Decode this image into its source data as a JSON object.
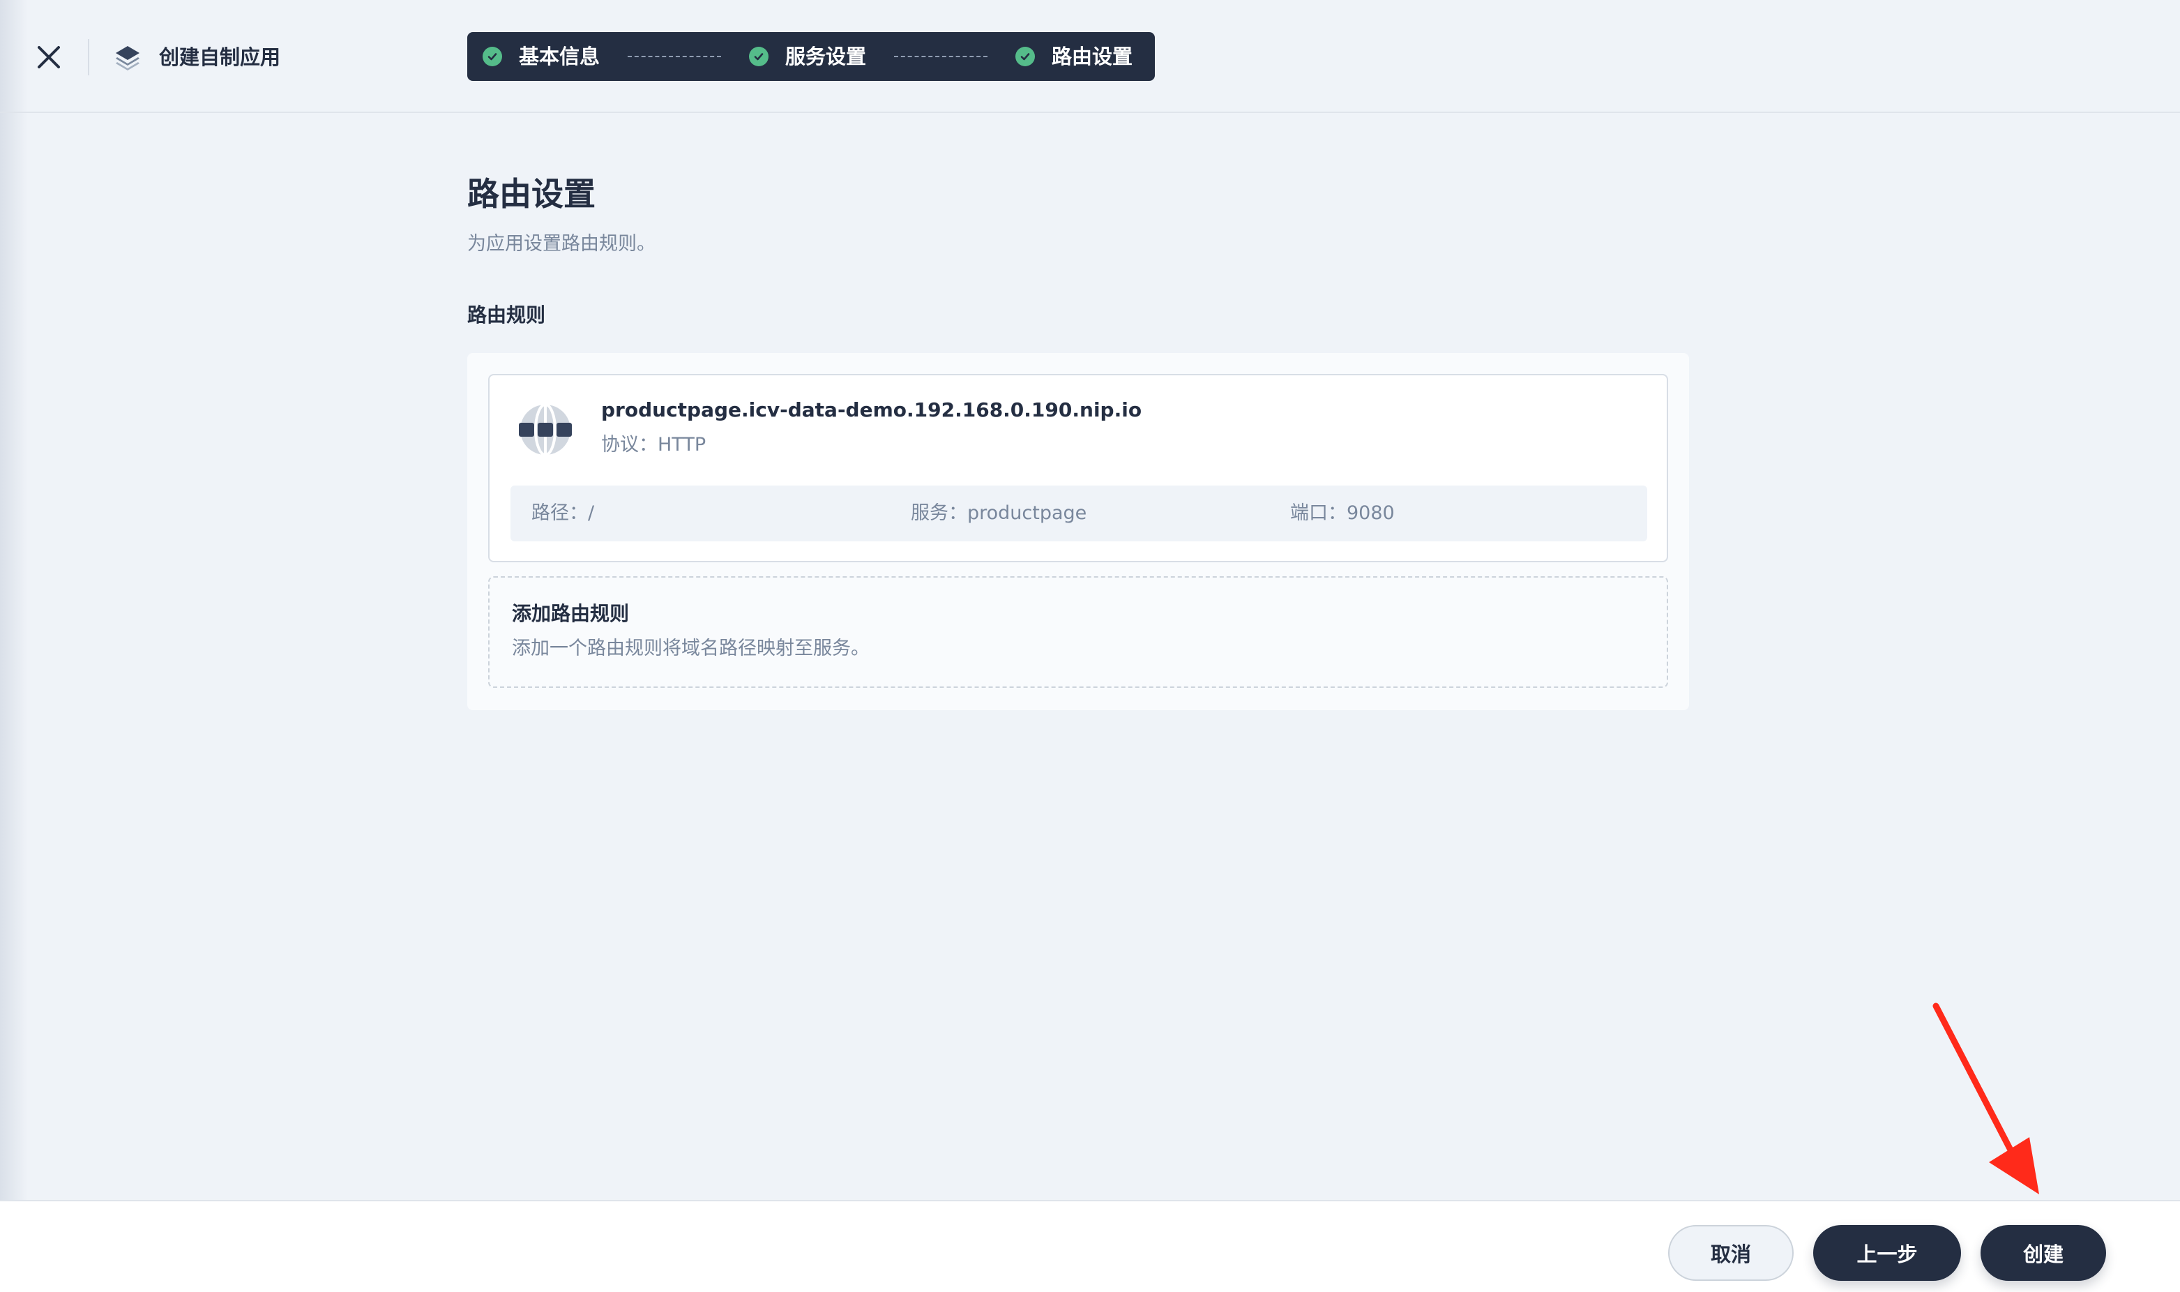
{
  "header": {
    "title": "创建自制应用",
    "close_icon": "close-icon",
    "app_icon": "layers-icon"
  },
  "steps": [
    {
      "label": "基本信息",
      "status": "completed"
    },
    {
      "label": "服务设置",
      "status": "completed"
    },
    {
      "label": "路由设置",
      "status": "completed"
    }
  ],
  "main": {
    "title": "路由设置",
    "description": "为应用设置路由规则。",
    "section_label": "路由规则",
    "route": {
      "host": "productpage.icv-data-demo.192.168.0.190.nip.io",
      "protocol": "协议：HTTP",
      "path": "路径：/",
      "service": "服务：productpage",
      "port": "端口：9080",
      "icon": "globe-icon"
    },
    "add_rule": {
      "title": "添加路由规则",
      "description": "添加一个路由规则将域名路径映射至服务。"
    }
  },
  "footer": {
    "cancel_label": "取消",
    "prev_label": "上一步",
    "create_label": "创建"
  },
  "colors": {
    "primary_dark": "#242e42",
    "success_green": "#55bc8a",
    "background": "#eff3f8",
    "annotation_arrow": "#ff2a1a"
  }
}
